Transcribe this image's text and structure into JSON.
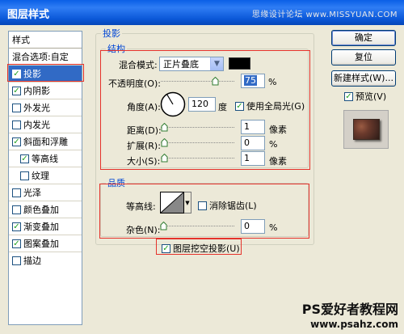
{
  "window": {
    "title": "图层样式",
    "watermark": "思缘设计论坛 www.MISSYUAN.COM"
  },
  "left_list": {
    "title": "样式",
    "items": [
      {
        "label": "混合选项:自定",
        "checkbox": false
      },
      {
        "label": "投影",
        "checkbox": true,
        "checked": true,
        "selected": true
      },
      {
        "label": "内阴影",
        "checkbox": true,
        "checked": true
      },
      {
        "label": "外发光",
        "checkbox": true,
        "checked": false
      },
      {
        "label": "内发光",
        "checkbox": true,
        "checked": false
      },
      {
        "label": "斜面和浮雕",
        "checkbox": true,
        "checked": true
      },
      {
        "label": "等高线",
        "checkbox": true,
        "checked": true,
        "sub": true
      },
      {
        "label": "纹理",
        "checkbox": true,
        "checked": false,
        "sub": true
      },
      {
        "label": "光泽",
        "checkbox": true,
        "checked": false
      },
      {
        "label": "颜色叠加",
        "checkbox": true,
        "checked": false
      },
      {
        "label": "渐变叠加",
        "checkbox": true,
        "checked": true
      },
      {
        "label": "图案叠加",
        "checkbox": true,
        "checked": true
      },
      {
        "label": "描边",
        "checkbox": true,
        "checked": false
      }
    ]
  },
  "drop_shadow": {
    "group_title": "投影",
    "structure": {
      "title": "结构",
      "blend_mode_label": "混合模式:",
      "blend_mode_value": "正片叠底",
      "shadow_color": "#000000",
      "opacity_label": "不透明度(O):",
      "opacity_value": "75",
      "opacity_unit": "%",
      "opacity_level": 0.75,
      "angle_label": "角度(A):",
      "angle_value": "120",
      "angle_unit": "度",
      "global_light_label": "使用全局光(G)",
      "global_light_checked": true,
      "distance_label": "距离(D):",
      "distance_value": "1",
      "distance_unit": "像素",
      "spread_label": "扩展(R):",
      "spread_value": "0",
      "spread_unit": "%",
      "size_label": "大小(S):",
      "size_value": "1",
      "size_unit": "像素"
    },
    "quality": {
      "title": "品质",
      "contour_label": "等高线:",
      "anti_aliased_label": "消除锯齿(L)",
      "anti_aliased_checked": false,
      "noise_label": "杂色(N):",
      "noise_value": "0",
      "noise_unit": "%"
    },
    "knockout_label": "图层挖空投影(U)",
    "knockout_checked": true
  },
  "buttons": {
    "ok": "确定",
    "reset": "复位",
    "new_style": "新建样式(W)...",
    "preview_label": "预览(V)",
    "preview_checked": true
  },
  "footer_watermark": {
    "line1": "PS爱好者教程网",
    "line2": "www.psahz.com"
  },
  "colors": {
    "titlebar": "#0a5fe6",
    "selected": "#316ac5",
    "group_title": "#0046d5",
    "annotation_red": "#e5322b"
  }
}
